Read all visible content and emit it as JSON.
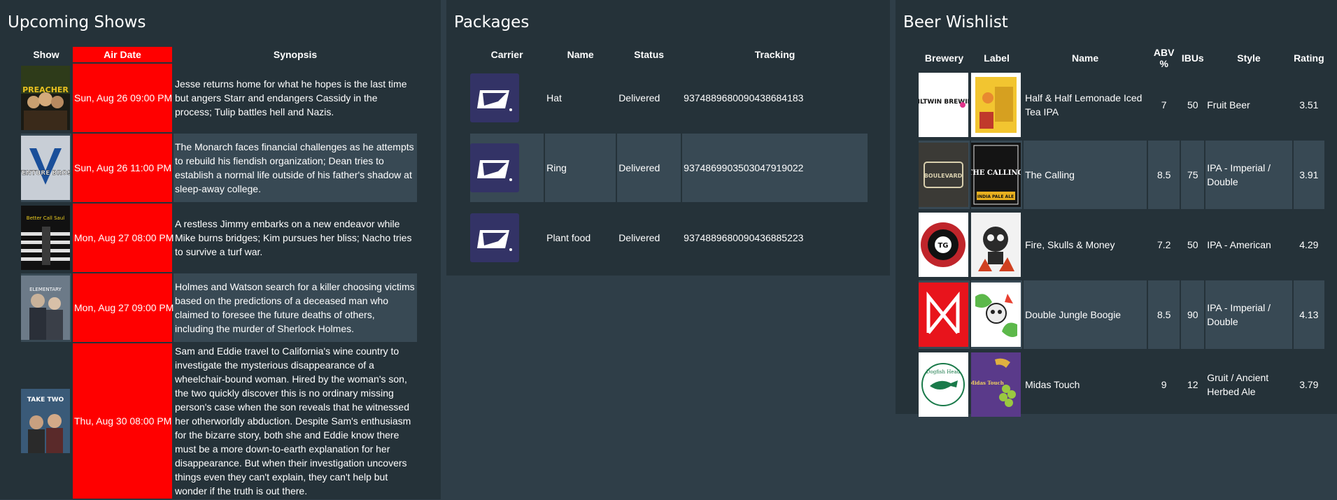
{
  "shows": {
    "title": "Upcoming Shows",
    "columns": [
      "Show",
      "Air Date",
      "Synopsis"
    ],
    "rows": [
      {
        "poster": "preacher-poster",
        "poster_text": "PREACHER",
        "air_date": "Sun, Aug 26 09:00 PM",
        "synopsis": "Jesse returns home for what he hopes is the last time but angers Starr and endangers Cassidy in the process; Tulip battles hell and Nazis."
      },
      {
        "poster": "venture-bros-poster",
        "poster_text": "VENTURE BROS.",
        "air_date": "Sun, Aug 26 11:00 PM",
        "synopsis": "The Monarch faces financial challenges as he attempts to rebuild his fiendish organization; Dean tries to establish a normal life outside of his father's shadow at sleep-away college."
      },
      {
        "poster": "better-call-saul-poster",
        "poster_text": "Better Call Saul",
        "air_date": "Mon, Aug 27 08:00 PM",
        "synopsis": "A restless Jimmy embarks on a new endeavor while Mike burns bridges; Kim pursues her bliss; Nacho tries to survive a turf war."
      },
      {
        "poster": "elementary-poster",
        "poster_text": "ELEMENTARY",
        "air_date": "Mon, Aug 27 09:00 PM",
        "synopsis": "Holmes and Watson search for a killer choosing victims based on the predictions of a deceased man who claimed to foresee the future deaths of others, including the murder of Sherlock Holmes."
      },
      {
        "poster": "take-two-poster",
        "poster_text": "TAKE TWO",
        "air_date": "Thu, Aug 30 08:00 PM",
        "synopsis": "Sam and Eddie travel to California's wine country to investigate the mysterious disappearance of a wheelchair-bound woman. Hired by the woman's son, the two quickly discover this is no ordinary missing person's case when the son reveals that he witnessed her otherworldly abduction. Despite Sam's enthusiasm for the bizarre story, both she and Eddie know there must be a more down-to-earth explanation for her disappearance. But when their investigation uncovers things even they can't explain, they can't help but wonder if the truth is out there."
      }
    ]
  },
  "packages": {
    "title": "Packages",
    "columns": [
      "Carrier",
      "Name",
      "Status",
      "Tracking"
    ],
    "rows": [
      {
        "carrier": "usps-logo",
        "name": "Hat",
        "status": "Delivered",
        "tracking": "9374889680090438684183"
      },
      {
        "carrier": "usps-logo",
        "name": "Ring",
        "status": "Delivered",
        "tracking": "9374869903503047919022"
      },
      {
        "carrier": "usps-logo",
        "name": "Plant food",
        "status": "Delivered",
        "tracking": "9374889680090436885223"
      }
    ]
  },
  "beers": {
    "title": "Beer Wishlist",
    "columns": [
      "Brewery",
      "Label",
      "Name",
      "ABV %",
      "IBUs",
      "Style",
      "Rating"
    ],
    "rows": [
      {
        "brewery": "evil-twin-logo",
        "brewery_text": "EVILTWIN BREWING",
        "label": "half-and-half-label",
        "name": "Half & Half Lemonade Iced Tea IPA",
        "abv": "7",
        "ibus": "50",
        "style": "Fruit Beer",
        "rating": "3.51"
      },
      {
        "brewery": "boulevard-logo",
        "brewery_text": "BOULEVARD",
        "label": "the-calling-label",
        "label_text": "THE CALLING",
        "label_sub": "INDIA PALE ALE",
        "name": "The Calling",
        "abv": "8.5",
        "ibus": "75",
        "style": "IPA - Imperial / Double",
        "rating": "3.91"
      },
      {
        "brewery": "toppling-goliath-logo",
        "brewery_text": "TG",
        "label": "fire-skulls-money-label",
        "name": "Fire, Skulls & Money",
        "abv": "7.2",
        "ibus": "50",
        "style": "IPA - American",
        "rating": "4.29"
      },
      {
        "brewery": "mikkeller-logo",
        "label": "double-jungle-boogie-label",
        "name": "Double Jungle Boogie",
        "abv": "8.5",
        "ibus": "90",
        "style": "IPA - Imperial / Double",
        "rating": "4.13"
      },
      {
        "brewery": "dogfish-head-logo",
        "brewery_text": "Dogfish Head",
        "label": "midas-touch-label",
        "label_text": "Midas Touch",
        "name": "Midas Touch",
        "abv": "9",
        "ibus": "12",
        "style": "Gruit / Ancient Herbed Ale",
        "rating": "3.79"
      }
    ]
  },
  "colors": {
    "page_bg": "#2f3e48",
    "card_bg": "#253239",
    "row_alt": "#384954",
    "air_date": "#ff0000",
    "usps_blue": "#333366"
  }
}
